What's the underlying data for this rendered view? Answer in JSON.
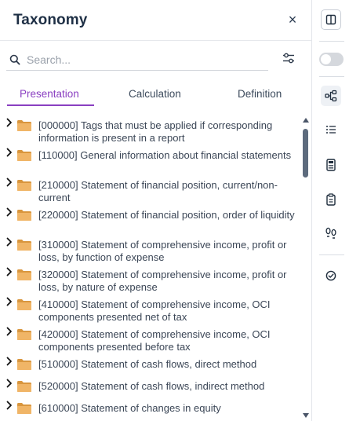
{
  "panel": {
    "title": "Taxonomy",
    "close_label": "×"
  },
  "search": {
    "placeholder": "Search...",
    "value": ""
  },
  "tabs": [
    {
      "label": "Presentation",
      "active": true
    },
    {
      "label": "Calculation",
      "active": false
    },
    {
      "label": "Definition",
      "active": false
    }
  ],
  "items": [
    {
      "label": "[000000] Tags that must be applied if corresponding information is present in a report"
    },
    {
      "label": "[110000] General information about financial statements"
    },
    {
      "label": "[210000] Statement of financial position, current/non-current"
    },
    {
      "label": "[220000] Statement of financial position, order of liquidity"
    },
    {
      "label": "[310000] Statement of comprehensive income, profit or loss, by function of expense"
    },
    {
      "label": "[320000] Statement of comprehensive income, profit or loss, by nature of expense"
    },
    {
      "label": "[410000] Statement of comprehensive income, OCI components presented net of tax"
    },
    {
      "label": "[420000] Statement of comprehensive income, OCI components presented before tax"
    },
    {
      "label": "[510000] Statement of cash flows, direct method"
    },
    {
      "label": "[520000] Statement of cash flows, indirect method"
    },
    {
      "label": "[610000] Statement of changes in equity"
    }
  ],
  "rail": {
    "toggle_on": false,
    "icons": [
      "panel-layout-icon",
      "tree-icon",
      "list-icon",
      "calculator-icon",
      "clipboard-icon",
      "footprints-icon",
      "check-circle-icon"
    ]
  },
  "colors": {
    "accent": "#8a3fc1",
    "folder": "#f0b567",
    "folder_dark": "#d9963e"
  }
}
